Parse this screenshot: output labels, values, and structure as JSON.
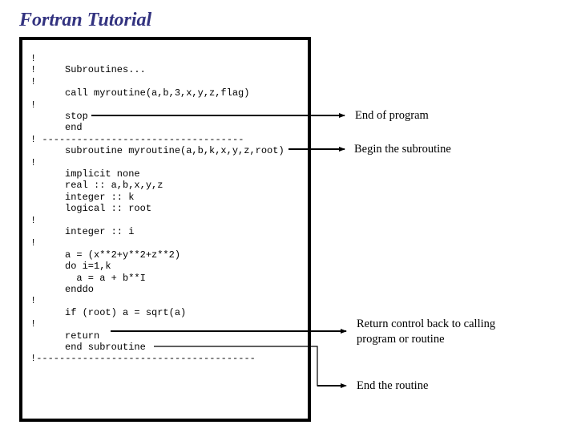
{
  "header": {
    "title": "Fortran Tutorial"
  },
  "code": {
    "lines": [
      {
        "mark": "!",
        "text": ""
      },
      {
        "mark": "!",
        "text": "Subroutines..."
      },
      {
        "mark": "!",
        "text": ""
      },
      {
        "mark": "",
        "text": "call myroutine(a,b,3,x,y,z,flag)"
      },
      {
        "mark": "!",
        "text": ""
      },
      {
        "mark": "",
        "text": "stop"
      },
      {
        "mark": "",
        "text": "end"
      },
      {
        "mark": "! -----------------------------------",
        "text": ""
      },
      {
        "mark": "",
        "text": "subroutine myroutine(a,b,k,x,y,z,root)"
      },
      {
        "mark": "!",
        "text": ""
      },
      {
        "mark": "",
        "text": "implicit none"
      },
      {
        "mark": "",
        "text": "real :: a,b,x,y,z"
      },
      {
        "mark": "",
        "text": "integer :: k"
      },
      {
        "mark": "",
        "text": "logical :: root"
      },
      {
        "mark": "!",
        "text": ""
      },
      {
        "mark": "",
        "text": "integer :: i"
      },
      {
        "mark": "!",
        "text": ""
      },
      {
        "mark": "",
        "text": "a = (x**2+y**2+z**2)"
      },
      {
        "mark": "",
        "text": "do i=1,k"
      },
      {
        "mark": "",
        "text": "  a = a + b**I"
      },
      {
        "mark": "",
        "text": "enddo"
      },
      {
        "mark": "!",
        "text": ""
      },
      {
        "mark": "",
        "text": "if (root) a = sqrt(a)"
      },
      {
        "mark": "!",
        "text": ""
      },
      {
        "mark": "",
        "text": "return"
      },
      {
        "mark": "",
        "text": "end subroutine"
      },
      {
        "mark": "!--------------------------------------",
        "text": ""
      }
    ]
  },
  "annotations": {
    "end_of_program": "End of program",
    "begin_subroutine": "Begin the subroutine",
    "return_control": "Return control back to calling program or routine",
    "end_routine": "End the routine"
  },
  "colors": {
    "title": "#333380",
    "text": "#000000",
    "border": "#000000",
    "background": "#ffffff"
  }
}
